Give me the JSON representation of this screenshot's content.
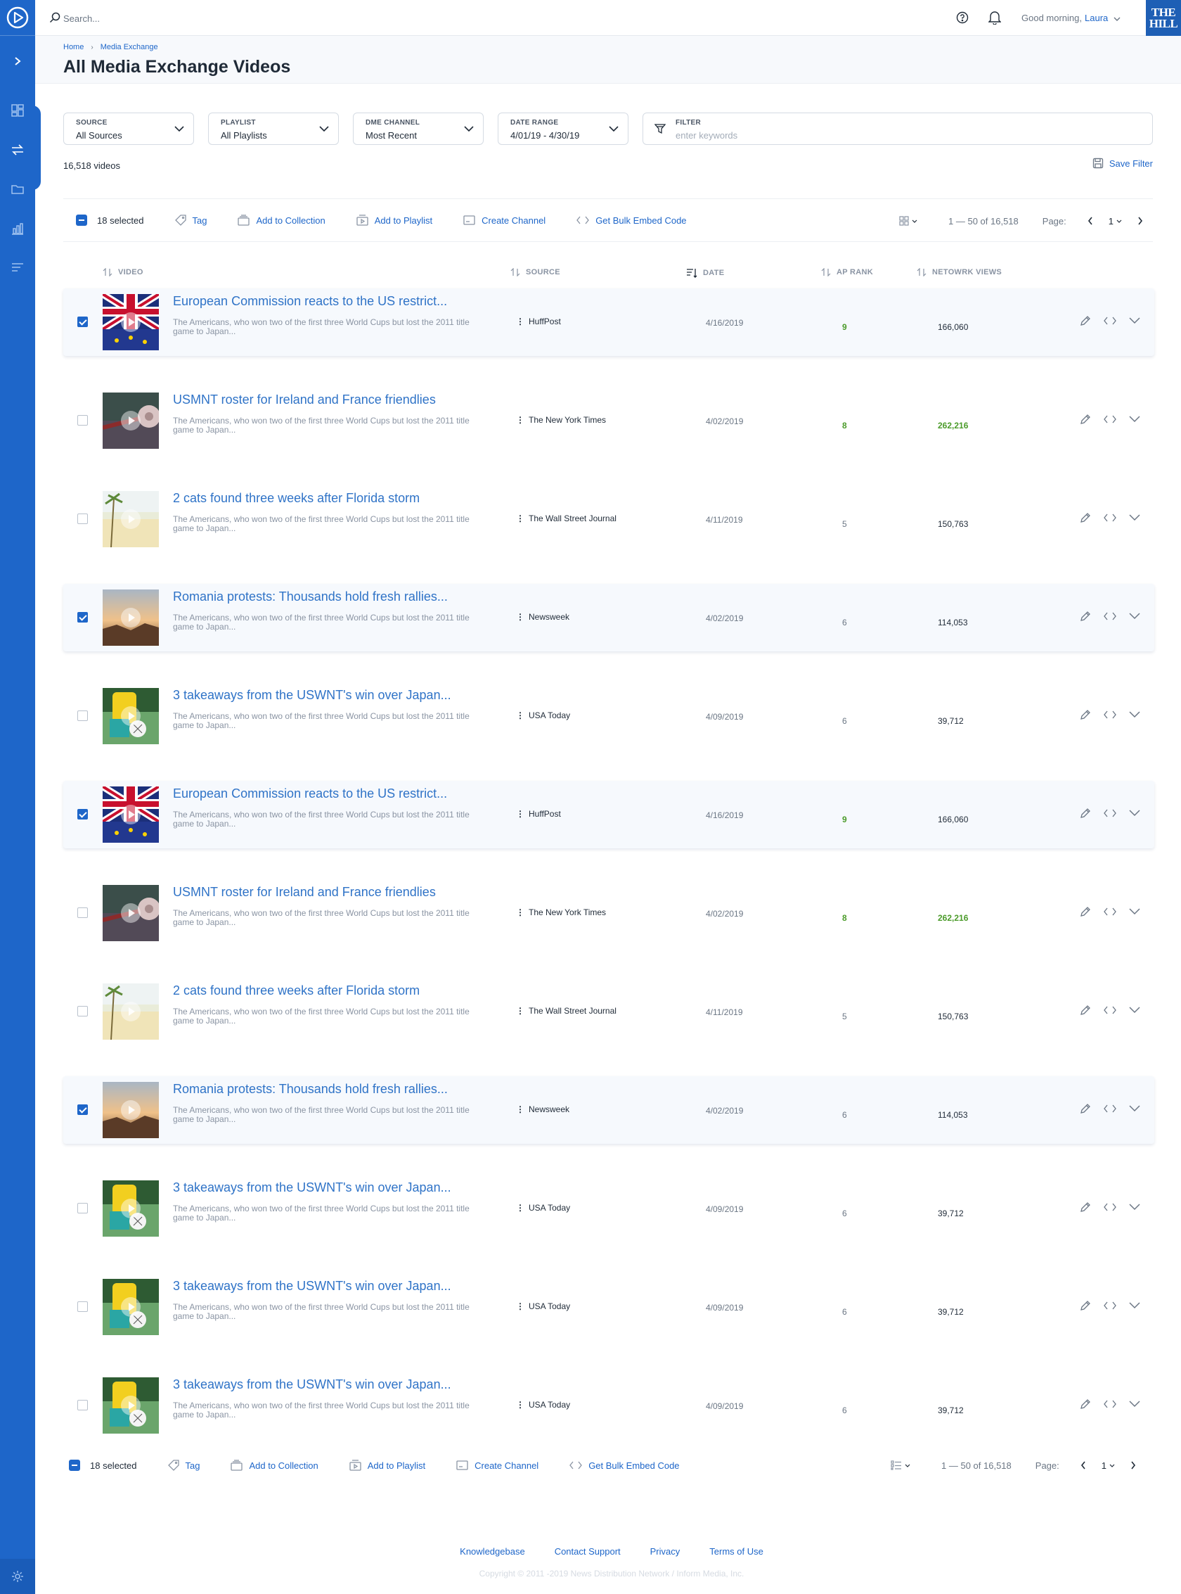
{
  "search": {
    "placeholder": "Search..."
  },
  "user": {
    "greeting": "Good morning,",
    "name": "Laura"
  },
  "brand": {
    "line1": "THE",
    "line2": "HILL"
  },
  "breadcrumb": [
    "Home",
    "Media Exchange"
  ],
  "page_title": "All Media Exchange Videos",
  "filters": [
    {
      "label": "SOURCE",
      "value": "All Sources"
    },
    {
      "label": "PLAYLIST",
      "value": "All Playlists"
    },
    {
      "label": "DME CHANNEL",
      "value": "Most Recent"
    },
    {
      "label": "DATE RANGE",
      "value": "4/01/19 - 4/30/19"
    }
  ],
  "keyword_filter": {
    "label": "FILTER",
    "placeholder": "enter keywords"
  },
  "video_count": "16,518 videos",
  "save_filter": "Save Filter",
  "bulk": {
    "selected": "18 selected",
    "tag": "Tag",
    "add_collection": "Add to Collection",
    "add_playlist": "Add to Playlist",
    "create_channel": "Create Channel",
    "embed": "Get Bulk Embed Code",
    "range": "1 — 50 of 16,518",
    "page_label": "Page:",
    "page": "1"
  },
  "columns": {
    "video": "VIDEO",
    "source": "SOURCE",
    "date": "DATE",
    "ap_rank": "AP RANK",
    "views": "NETOWRK VIEWS"
  },
  "rows": [
    {
      "title": "European Commission reacts to the US restrict...",
      "desc": "The Americans, who won two of the first three World Cups but lost the 2011 title game to Japan...",
      "source": "HuffPost",
      "date": "4/16/2019",
      "rank": "9",
      "views": "166,060",
      "selected": true,
      "thumb": "flag"
    },
    {
      "title": "USMNT roster for Ireland and France friendlies",
      "desc": "The Americans, who won two of the first three World Cups but lost the 2011 title game to Japan...",
      "source": "The New York Times",
      "date": "4/02/2019",
      "rank": "8",
      "views": "262,216",
      "selected": false,
      "thumb": "ball"
    },
    {
      "title": "2 cats found three weeks after Florida storm",
      "desc": "The Americans, who won two of the first three World Cups but lost the 2011 title game to Japan...",
      "source": "The Wall Street Journal",
      "date": "4/11/2019",
      "rank": "5",
      "views": "150,763",
      "selected": false,
      "thumb": "beach"
    },
    {
      "title": "Romania protests: Thousands hold fresh rallies...",
      "desc": "The Americans, who won two of the first three World Cups but lost the 2011 title game to Japan...",
      "source": "Newsweek",
      "date": "4/02/2019",
      "rank": "6",
      "views": "114,053",
      "selected": true,
      "thumb": "sunset"
    },
    {
      "title": "3 takeaways from the USWNT's win over Japan...",
      "desc": "The Americans, who won two of the first three World Cups but lost the 2011 title game to Japan...",
      "source": "USA Today",
      "date": "4/09/2019",
      "rank": "6",
      "views": "39,712",
      "selected": false,
      "thumb": "soccer"
    },
    {
      "title": "European Commission reacts to the US restrict...",
      "desc": "The Americans, who won two of the first three World Cups but lost the 2011 title game to Japan...",
      "source": "HuffPost",
      "date": "4/16/2019",
      "rank": "9",
      "views": "166,060",
      "selected": true,
      "thumb": "flag"
    },
    {
      "title": "USMNT roster for Ireland and France friendlies",
      "desc": "The Americans, who won two of the first three World Cups but lost the 2011 title game to Japan...",
      "source": "The New York Times",
      "date": "4/02/2019",
      "rank": "8",
      "views": "262,216",
      "selected": false,
      "thumb": "ball"
    },
    {
      "title": "2 cats found three weeks after Florida storm",
      "desc": "The Americans, who won two of the first three World Cups but lost the 2011 title game to Japan...",
      "source": "The Wall Street Journal",
      "date": "4/11/2019",
      "rank": "5",
      "views": "150,763",
      "selected": false,
      "thumb": "beach"
    },
    {
      "title": "Romania protests: Thousands hold fresh rallies...",
      "desc": "The Americans, who won two of the first three World Cups but lost the 2011 title game to Japan...",
      "source": "Newsweek",
      "date": "4/02/2019",
      "rank": "6",
      "views": "114,053",
      "selected": true,
      "thumb": "sunset"
    },
    {
      "title": "3 takeaways from the USWNT's win over Japan...",
      "desc": "The Americans, who won two of the first three World Cups but lost the 2011 title game to Japan...",
      "source": "USA Today",
      "date": "4/09/2019",
      "rank": "6",
      "views": "39,712",
      "selected": false,
      "thumb": "soccer"
    },
    {
      "title": "3 takeaways from the USWNT's win over Japan...",
      "desc": "The Americans, who won two of the first three World Cups but lost the 2011 title game to Japan...",
      "source": "USA Today",
      "date": "4/09/2019",
      "rank": "6",
      "views": "39,712",
      "selected": false,
      "thumb": "soccer"
    },
    {
      "title": "3 takeaways from the USWNT's win over Japan...",
      "desc": "The Americans, who won two of the first three World Cups but lost the 2011 title game to Japan...",
      "source": "USA Today",
      "date": "4/09/2019",
      "rank": "6",
      "views": "39,712",
      "selected": false,
      "thumb": "soccer"
    }
  ],
  "footer": {
    "links": [
      "Knowledgebase",
      "Contact Support",
      "Privacy",
      "Terms of Use"
    ],
    "copyright": "Copyright © 2011 -2019 News Distribution Network / Inform Media, Inc."
  },
  "colors": {
    "accent": "#1e66c9",
    "highlight": "#4b9b2a"
  }
}
